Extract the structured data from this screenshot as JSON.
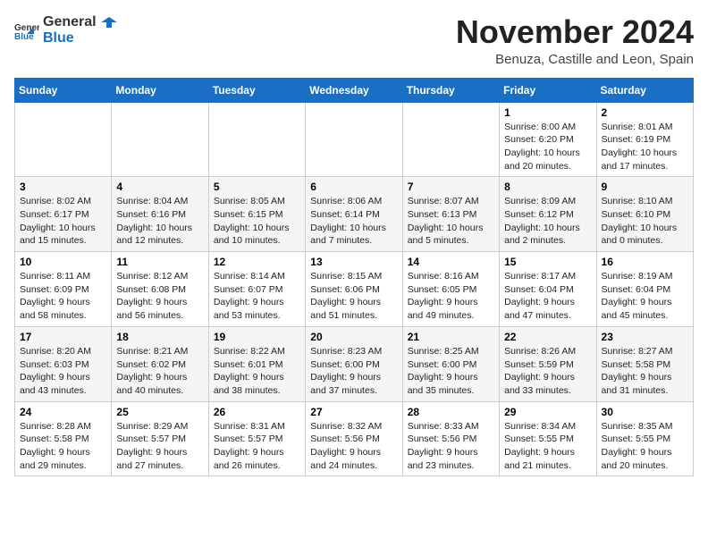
{
  "logo": {
    "general": "General",
    "blue": "Blue"
  },
  "header": {
    "month": "November 2024",
    "location": "Benuza, Castille and Leon, Spain"
  },
  "weekdays": [
    "Sunday",
    "Monday",
    "Tuesday",
    "Wednesday",
    "Thursday",
    "Friday",
    "Saturday"
  ],
  "weeks": [
    [
      {
        "day": "",
        "info": ""
      },
      {
        "day": "",
        "info": ""
      },
      {
        "day": "",
        "info": ""
      },
      {
        "day": "",
        "info": ""
      },
      {
        "day": "",
        "info": ""
      },
      {
        "day": "1",
        "info": "Sunrise: 8:00 AM\nSunset: 6:20 PM\nDaylight: 10 hours\nand 20 minutes."
      },
      {
        "day": "2",
        "info": "Sunrise: 8:01 AM\nSunset: 6:19 PM\nDaylight: 10 hours\nand 17 minutes."
      }
    ],
    [
      {
        "day": "3",
        "info": "Sunrise: 8:02 AM\nSunset: 6:17 PM\nDaylight: 10 hours\nand 15 minutes."
      },
      {
        "day": "4",
        "info": "Sunrise: 8:04 AM\nSunset: 6:16 PM\nDaylight: 10 hours\nand 12 minutes."
      },
      {
        "day": "5",
        "info": "Sunrise: 8:05 AM\nSunset: 6:15 PM\nDaylight: 10 hours\nand 10 minutes."
      },
      {
        "day": "6",
        "info": "Sunrise: 8:06 AM\nSunset: 6:14 PM\nDaylight: 10 hours\nand 7 minutes."
      },
      {
        "day": "7",
        "info": "Sunrise: 8:07 AM\nSunset: 6:13 PM\nDaylight: 10 hours\nand 5 minutes."
      },
      {
        "day": "8",
        "info": "Sunrise: 8:09 AM\nSunset: 6:12 PM\nDaylight: 10 hours\nand 2 minutes."
      },
      {
        "day": "9",
        "info": "Sunrise: 8:10 AM\nSunset: 6:10 PM\nDaylight: 10 hours\nand 0 minutes."
      }
    ],
    [
      {
        "day": "10",
        "info": "Sunrise: 8:11 AM\nSunset: 6:09 PM\nDaylight: 9 hours\nand 58 minutes."
      },
      {
        "day": "11",
        "info": "Sunrise: 8:12 AM\nSunset: 6:08 PM\nDaylight: 9 hours\nand 56 minutes."
      },
      {
        "day": "12",
        "info": "Sunrise: 8:14 AM\nSunset: 6:07 PM\nDaylight: 9 hours\nand 53 minutes."
      },
      {
        "day": "13",
        "info": "Sunrise: 8:15 AM\nSunset: 6:06 PM\nDaylight: 9 hours\nand 51 minutes."
      },
      {
        "day": "14",
        "info": "Sunrise: 8:16 AM\nSunset: 6:05 PM\nDaylight: 9 hours\nand 49 minutes."
      },
      {
        "day": "15",
        "info": "Sunrise: 8:17 AM\nSunset: 6:04 PM\nDaylight: 9 hours\nand 47 minutes."
      },
      {
        "day": "16",
        "info": "Sunrise: 8:19 AM\nSunset: 6:04 PM\nDaylight: 9 hours\nand 45 minutes."
      }
    ],
    [
      {
        "day": "17",
        "info": "Sunrise: 8:20 AM\nSunset: 6:03 PM\nDaylight: 9 hours\nand 43 minutes."
      },
      {
        "day": "18",
        "info": "Sunrise: 8:21 AM\nSunset: 6:02 PM\nDaylight: 9 hours\nand 40 minutes."
      },
      {
        "day": "19",
        "info": "Sunrise: 8:22 AM\nSunset: 6:01 PM\nDaylight: 9 hours\nand 38 minutes."
      },
      {
        "day": "20",
        "info": "Sunrise: 8:23 AM\nSunset: 6:00 PM\nDaylight: 9 hours\nand 37 minutes."
      },
      {
        "day": "21",
        "info": "Sunrise: 8:25 AM\nSunset: 6:00 PM\nDaylight: 9 hours\nand 35 minutes."
      },
      {
        "day": "22",
        "info": "Sunrise: 8:26 AM\nSunset: 5:59 PM\nDaylight: 9 hours\nand 33 minutes."
      },
      {
        "day": "23",
        "info": "Sunrise: 8:27 AM\nSunset: 5:58 PM\nDaylight: 9 hours\nand 31 minutes."
      }
    ],
    [
      {
        "day": "24",
        "info": "Sunrise: 8:28 AM\nSunset: 5:58 PM\nDaylight: 9 hours\nand 29 minutes."
      },
      {
        "day": "25",
        "info": "Sunrise: 8:29 AM\nSunset: 5:57 PM\nDaylight: 9 hours\nand 27 minutes."
      },
      {
        "day": "26",
        "info": "Sunrise: 8:31 AM\nSunset: 5:57 PM\nDaylight: 9 hours\nand 26 minutes."
      },
      {
        "day": "27",
        "info": "Sunrise: 8:32 AM\nSunset: 5:56 PM\nDaylight: 9 hours\nand 24 minutes."
      },
      {
        "day": "28",
        "info": "Sunrise: 8:33 AM\nSunset: 5:56 PM\nDaylight: 9 hours\nand 23 minutes."
      },
      {
        "day": "29",
        "info": "Sunrise: 8:34 AM\nSunset: 5:55 PM\nDaylight: 9 hours\nand 21 minutes."
      },
      {
        "day": "30",
        "info": "Sunrise: 8:35 AM\nSunset: 5:55 PM\nDaylight: 9 hours\nand 20 minutes."
      }
    ]
  ]
}
